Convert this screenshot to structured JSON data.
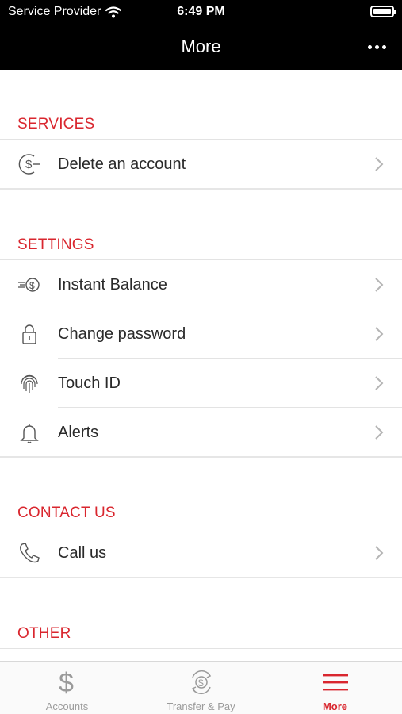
{
  "status_bar": {
    "carrier": "Service Provider",
    "time": "6:49 PM"
  },
  "nav": {
    "title": "More"
  },
  "sections": [
    {
      "header": "SERVICES",
      "items": [
        {
          "label": "Delete an account",
          "icon": "dollar-circle-minus-icon"
        }
      ]
    },
    {
      "header": "SETTINGS",
      "items": [
        {
          "label": "Instant Balance",
          "icon": "fast-dollar-icon"
        },
        {
          "label": "Change password",
          "icon": "lock-icon"
        },
        {
          "label": "Touch ID",
          "icon": "fingerprint-icon"
        },
        {
          "label": "Alerts",
          "icon": "bell-icon"
        }
      ]
    },
    {
      "header": "CONTACT US",
      "items": [
        {
          "label": "Call us",
          "icon": "phone-icon"
        }
      ]
    },
    {
      "header": "OTHER",
      "items": []
    }
  ],
  "tab_bar": {
    "tabs": [
      {
        "label": "Accounts",
        "icon": "dollar-icon",
        "active": false
      },
      {
        "label": "Transfer & Pay",
        "icon": "transfer-dollar-icon",
        "active": false
      },
      {
        "label": "More",
        "icon": "menu-icon",
        "active": true
      }
    ]
  },
  "colors": {
    "accent": "#d9262e",
    "bar_background": "#000000",
    "tab_inactive": "#9a9a9a"
  }
}
